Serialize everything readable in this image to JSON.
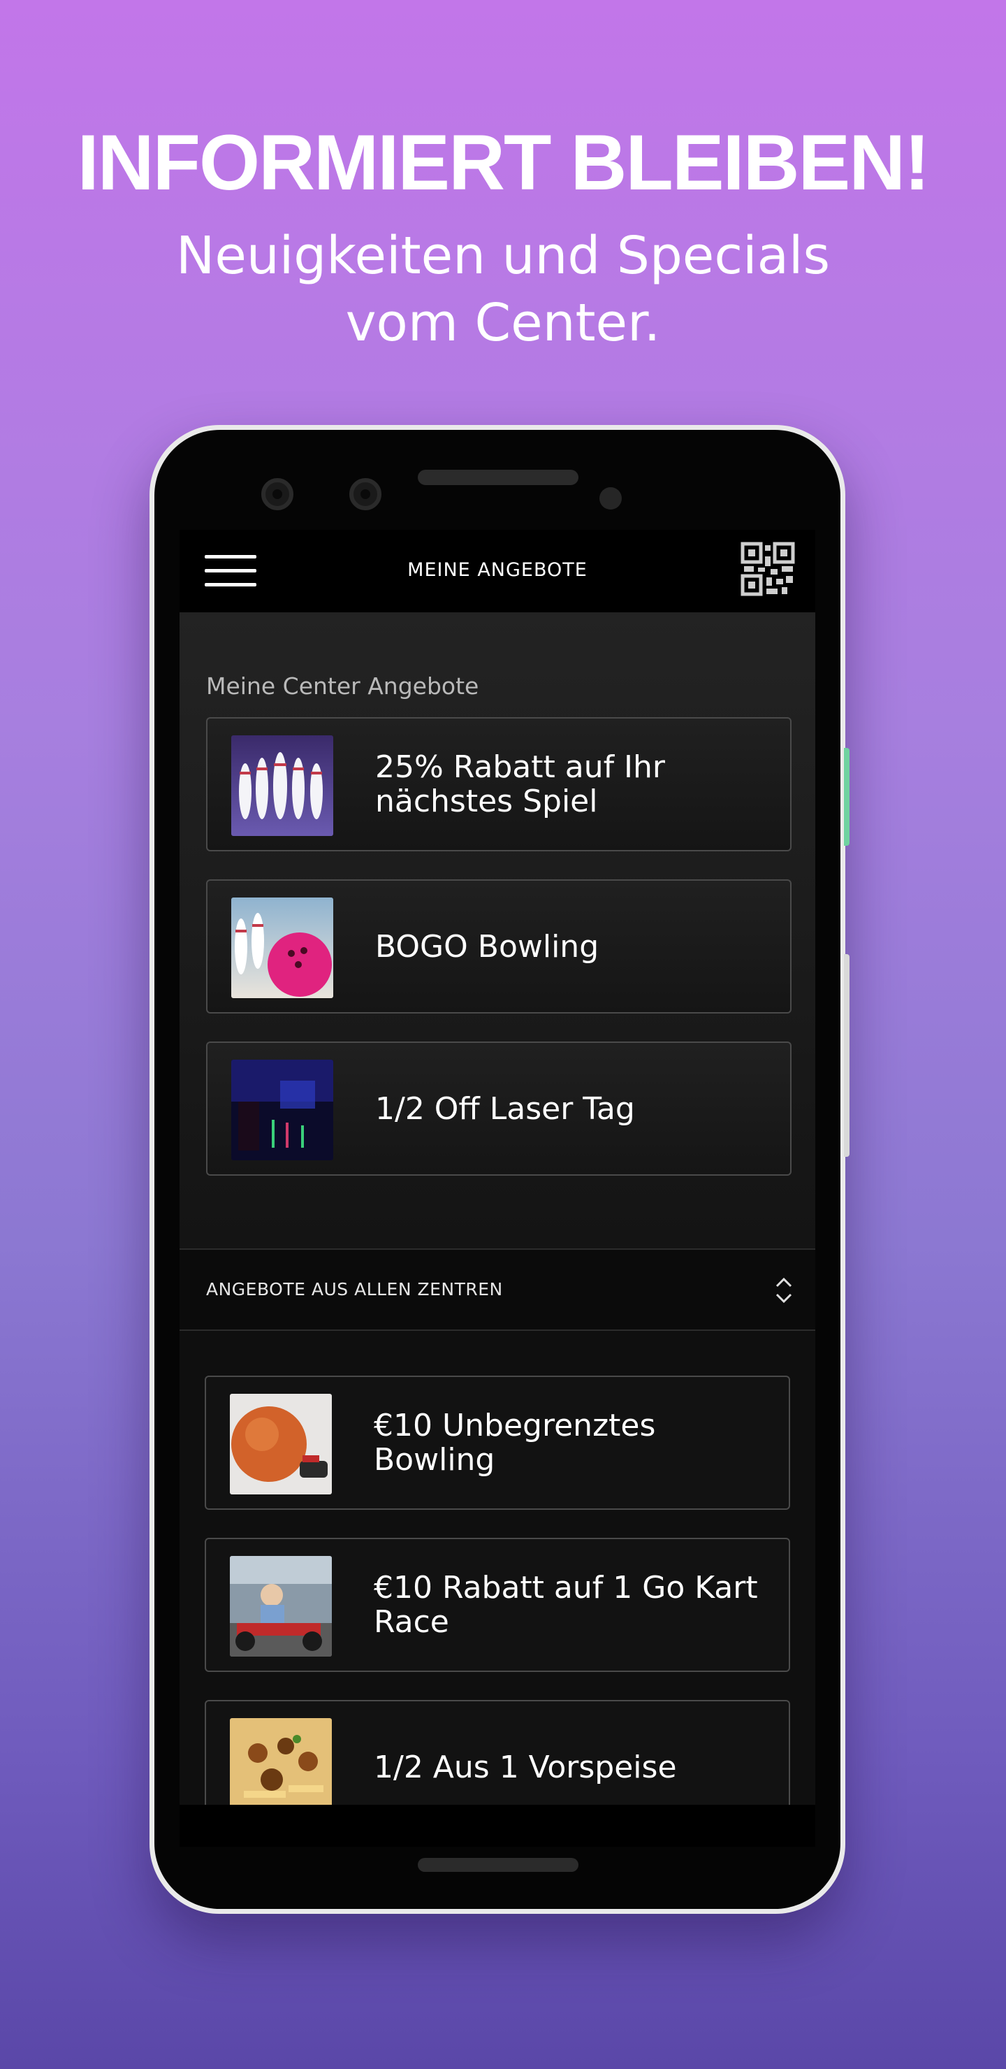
{
  "promo": {
    "headline": "INFORMIERT BLEIBEN!",
    "subline_1": "Neuigkeiten und Specials",
    "subline_2": "vom Center."
  },
  "appbar": {
    "title": "MEINE ANGEBOTE",
    "menu_icon": "hamburger-menu-icon",
    "qr_icon": "qr-code-icon"
  },
  "my_center": {
    "section_label": "Meine Center Angebote",
    "offers": [
      {
        "line1": "25% Rabatt auf Ihr",
        "line2": "nächstes Spiel",
        "image": "bowling-pins"
      },
      {
        "line1": "BOGO Bowling",
        "line2": "",
        "image": "pink-bowling-ball"
      },
      {
        "line1": "1/2 Off Laser Tag",
        "line2": "",
        "image": "laser-tag-arena"
      }
    ]
  },
  "all_centers": {
    "label": "ANGEBOTE AUS ALLEN ZENTREN",
    "sort_icon": "chevron-up-down-icon",
    "offers": [
      {
        "line1": "€10 Unbegrenztes",
        "line2": "Bowling",
        "image": "orange-bowling-ball"
      },
      {
        "line1": "€10 Rabatt auf 1 Go Kart",
        "line2": "Race",
        "image": "go-kart"
      },
      {
        "line1": "1/2 Aus 1 Vorspeise",
        "line2": "",
        "image": "appetizer-food"
      }
    ]
  },
  "colors": {
    "background_top": "#c276e9",
    "background_bottom": "#5a47a8",
    "screen": "#000000",
    "card_border": "#4a4a4a",
    "text": "#ffffff"
  }
}
